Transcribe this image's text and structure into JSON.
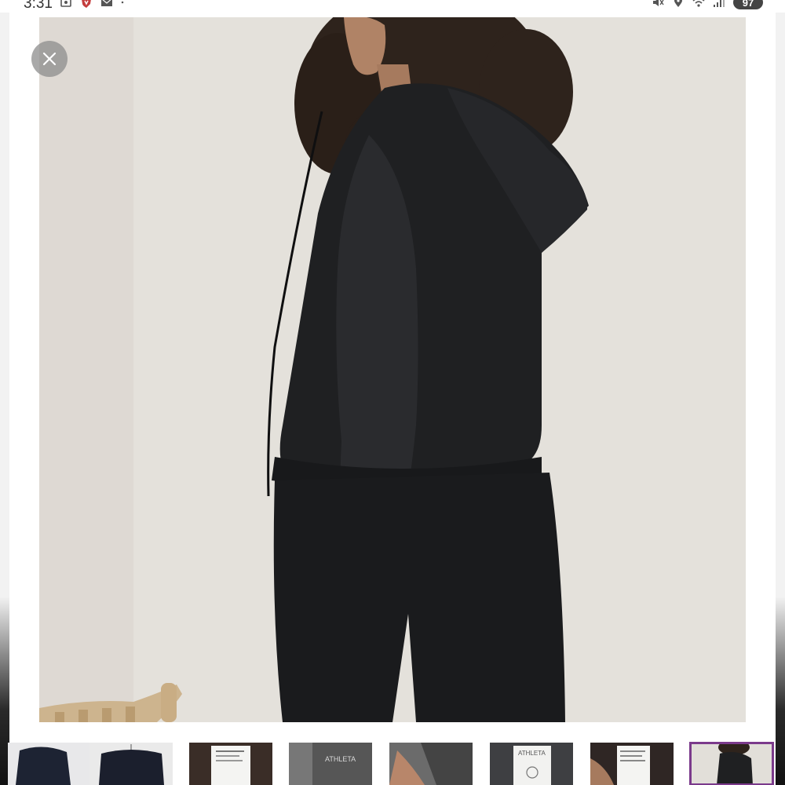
{
  "status_bar": {
    "time": "3:31",
    "left_icons": [
      "screenshot-icon",
      "shield-icon",
      "mail-icon",
      "dot-icon"
    ],
    "right_icons": [
      "mute-icon",
      "location-icon",
      "wifi-icon",
      "signal-icon"
    ],
    "battery": "97"
  },
  "viewer": {
    "close_icon": "close-icon"
  },
  "thumbnails": [
    {
      "label": "",
      "selected": false
    },
    {
      "label": "",
      "selected": false
    },
    {
      "label": "",
      "selected": false
    },
    {
      "label": "ATHLETA",
      "selected": false
    },
    {
      "label": "",
      "selected": false
    },
    {
      "label": "ATHLETA",
      "selected": false
    },
    {
      "label": "",
      "selected": false
    },
    {
      "label": "",
      "selected": true
    }
  ],
  "colors": {
    "selected_thumbnail_outline": "#7b3a8b",
    "hoodie": "#1e1f21",
    "backdrop": "#e6e3dd"
  }
}
